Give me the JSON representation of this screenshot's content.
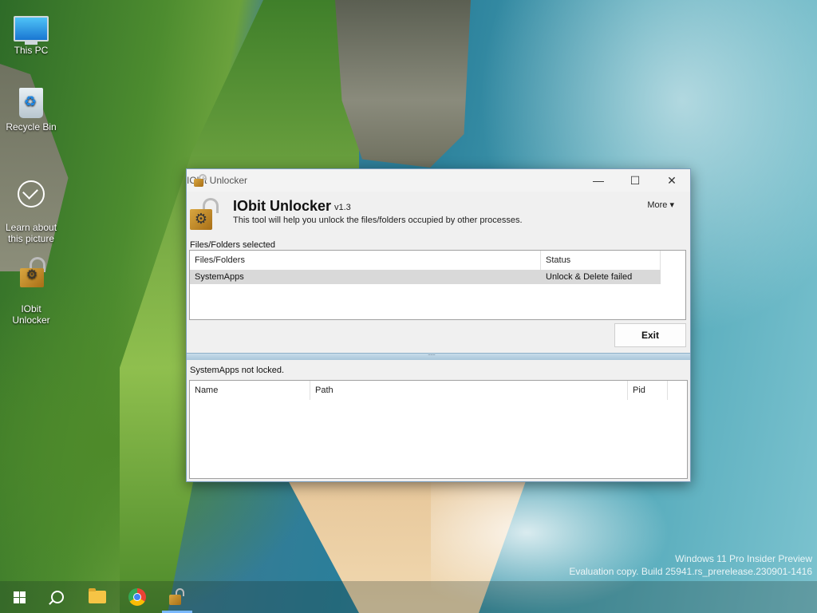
{
  "desktop": {
    "icons": [
      {
        "label": "This PC",
        "icon": "computer-icon"
      },
      {
        "label": "Recycle Bin",
        "icon": "recycle-bin-icon"
      },
      {
        "label": "Learn about\nthis picture",
        "icon": "learn-about-picture-icon"
      },
      {
        "label": "IObit\nUnlocker",
        "icon": "iobit-unlocker-icon"
      }
    ],
    "watermark": {
      "line1": "Windows 11 Pro Insider Preview",
      "line2": "Evaluation copy. Build 25941.rs_prerelease.230901-1416"
    }
  },
  "window": {
    "title": "IObit Unlocker",
    "controls": {
      "minimize": "—",
      "maximize": "☐",
      "close": "✕"
    },
    "app_name": "IObit Unlocker",
    "version": "v1.3",
    "description": "This tool will help you unlock the files/folders occupied by other processes.",
    "more_label": "More",
    "files_section_label": "Files/Folders selected",
    "files_table": {
      "columns": [
        "Files/Folders",
        "Status"
      ],
      "rows": [
        {
          "name": "SystemApps",
          "status": "Unlock & Delete failed"
        }
      ]
    },
    "exit_label": "Exit",
    "status_message": "SystemApps not locked.",
    "process_table": {
      "columns": [
        "Name",
        "Path",
        "Pid"
      ],
      "rows": []
    }
  },
  "taskbar": {
    "items": [
      "start-icon",
      "search-icon",
      "file-explorer-icon",
      "chrome-icon",
      "iobit-unlocker-icon"
    ]
  }
}
